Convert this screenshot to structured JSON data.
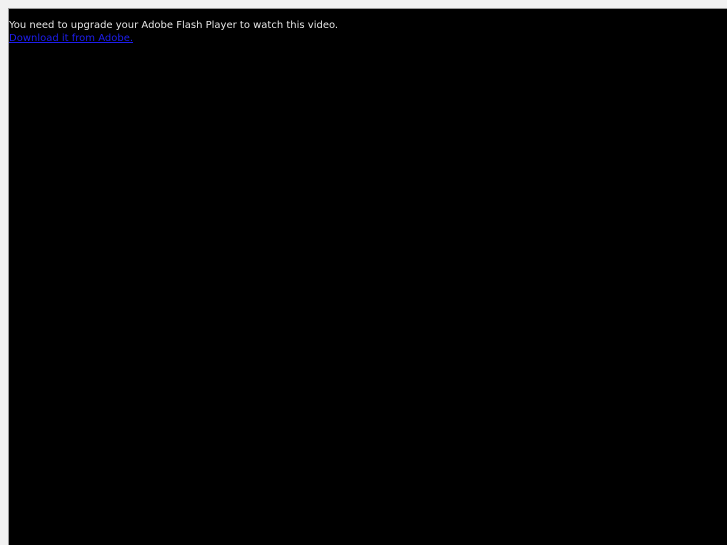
{
  "flash_notice": {
    "message": "You need to upgrade your Adobe Flash Player to watch this video.",
    "download_link": "Download it from Adobe."
  },
  "colors": {
    "page_background": "#f1f1f1",
    "player_background": "#000000",
    "message_text": "#e6e6e6",
    "link_text": "#1e1ef0"
  }
}
